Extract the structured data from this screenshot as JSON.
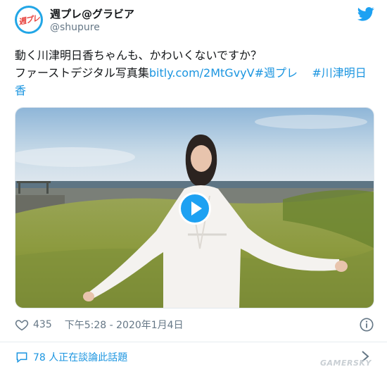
{
  "author": {
    "avatar_text": "週プレ",
    "display_name": "週プレ@グラビア",
    "handle": "@shupure"
  },
  "tweet": {
    "line1": "動く川津明日香ちゃんも、かわいくないですか？",
    "line2_prefix": "ファーストデジタル写真集",
    "link_url": "bitly.com/2MtGvyV",
    "hashtag1": "#週プレ",
    "hashtag2": "#川津明日香"
  },
  "meta": {
    "like_count": "435",
    "timestamp": "下午5:28 - 2020年1月4日"
  },
  "conversation": {
    "label": "78 人正在談論此話題"
  },
  "watermark": "GAMERSKY",
  "colors": {
    "link": "#1b95e0",
    "twitter_blue": "#1da1f2",
    "secondary_text": "#657786"
  },
  "icons": [
    "twitter-bird-icon",
    "heart-icon",
    "info-icon",
    "speech-bubble-icon",
    "chevron-right-icon",
    "play-icon"
  ]
}
